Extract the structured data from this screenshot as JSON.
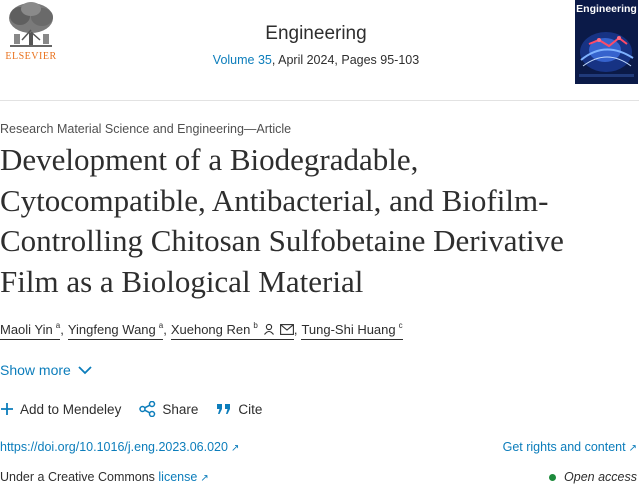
{
  "header": {
    "publisher": "ELSEVIER",
    "journal": "Engineering",
    "volume_link": "Volume 35",
    "issue_info": ", April 2024, Pages 95-103",
    "cover_title": "Engineering"
  },
  "article": {
    "type": "Research Material Science and Engineering—Article",
    "title_lines": [
      "Development of a Biodegradable,",
      "Cytocompatible, Antibacterial, and Biofilm-",
      "Controlling Chitosan Sulfobetaine Derivative",
      "Film as a Biological Material"
    ],
    "authors": [
      {
        "name": "Maoli Yin",
        "sup": "a"
      },
      {
        "name": "Yingfeng Wang",
        "sup": "a"
      },
      {
        "name": "Xuehong Ren",
        "sup": "b"
      },
      {
        "name": "Tung-Shi Huang",
        "sup": "c"
      }
    ],
    "show_more": "Show more"
  },
  "actions": {
    "mendeley": "Add to Mendeley",
    "share": "Share",
    "cite": "Cite"
  },
  "links": {
    "doi": "https://doi.org/10.1016/j.eng.2023.06.020",
    "rights": "Get rights and content",
    "license_prefix": "Under a Creative Commons ",
    "license": "license",
    "open_access": "Open access"
  },
  "colors": {
    "link": "#0c7dbb",
    "publisher_orange": "#e9711c",
    "open_access_green": "#1c8a3b"
  }
}
